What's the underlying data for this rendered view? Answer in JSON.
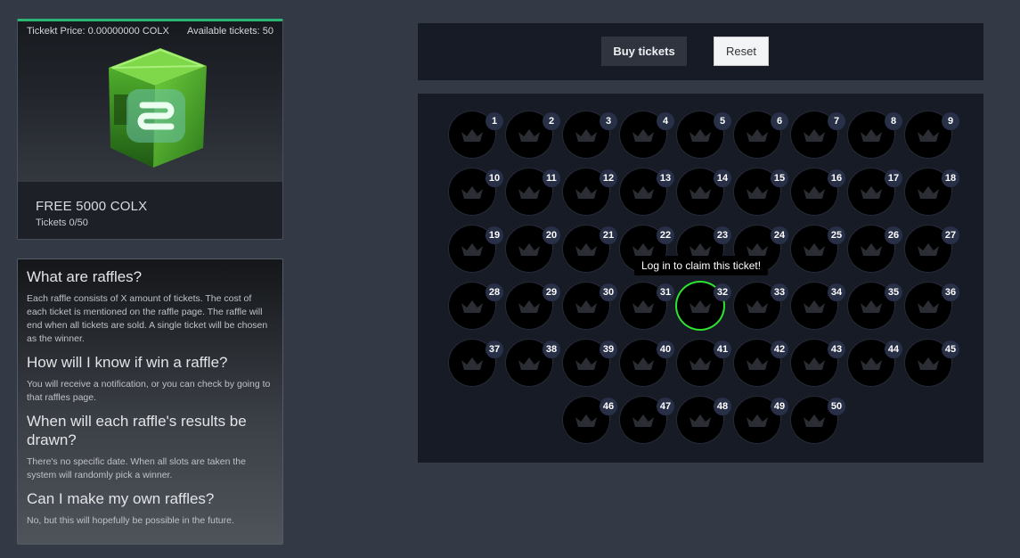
{
  "raffle": {
    "price_label": "Tickekt Price: 0.00000000 COLX",
    "available_label": "Available tickets: 50",
    "title": "FREE 5000 COLX",
    "tickets_label": "Tickets 0/50",
    "image_icon": "green-crate-with-colx-logo",
    "accent_color": "#2bb673"
  },
  "faq": [
    {
      "q": "What are raffles?",
      "a": "Each raffle consists of X amount of tickets. The cost of each ticket is mentioned on the raffle page. The raffle will end when all tickets are sold. A single ticket will be chosen as the winner."
    },
    {
      "q": "How will I know if win a raffle?",
      "a": "You will receive a notification, or you can check by going to that raffles page."
    },
    {
      "q": "When will each raffle's results be drawn?",
      "a": "There's no specific date. When all slots are taken the system will randomly pick a winner."
    },
    {
      "q": "Can I make my own raffles?",
      "a": "No, but this will hopefully be possible in the future."
    }
  ],
  "toolbar": {
    "buy_label": "Buy tickets",
    "reset_label": "Reset"
  },
  "tickets": {
    "count": 50,
    "selected": 32,
    "tooltip": "Log in to claim this ticket!",
    "ticket_icon": "crown-icon",
    "highlight_color": "#2ee52e"
  }
}
